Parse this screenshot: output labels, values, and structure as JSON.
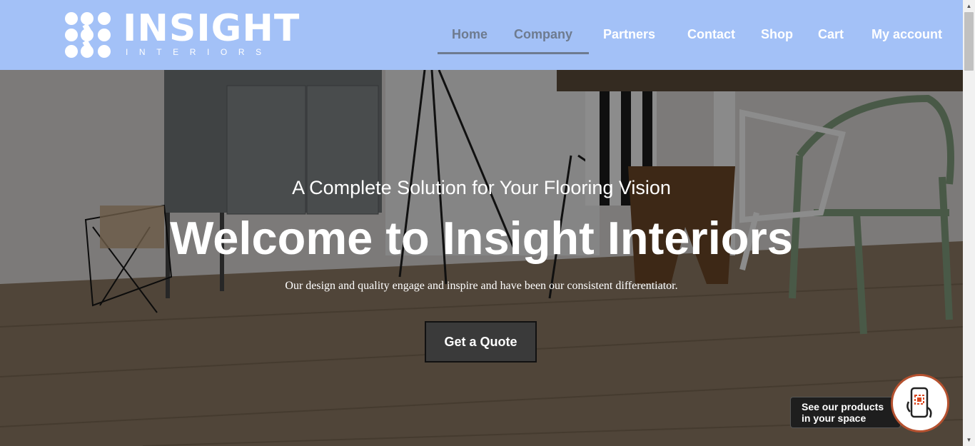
{
  "brand": {
    "name": "INSIGHT",
    "sub": "INTERIORS"
  },
  "nav": {
    "items": [
      {
        "label": "Home",
        "active": true
      },
      {
        "label": "Company",
        "active": false
      },
      {
        "label": "Partners",
        "active": false
      },
      {
        "label": "Contact",
        "active": false
      },
      {
        "label": "Shop",
        "active": false
      },
      {
        "label": "Cart",
        "active": false
      },
      {
        "label": "My account",
        "active": false
      }
    ]
  },
  "hero": {
    "tagline": "A Complete Solution for Your Flooring Vision",
    "title": "Welcome to Insight Interiors",
    "description": "Our design and quality engage and inspire and have been our consistent differentiator.",
    "cta_label": "Get a Quote"
  },
  "ar_widget": {
    "line1": "See our products",
    "line2": "in your space",
    "icon": "phone-ar-icon"
  },
  "colors": {
    "header_bg": "#a3c1f7",
    "nav_active": "#6e7b8f",
    "cta_bg": "#3a3a3a",
    "ar_accent": "#b5512f"
  }
}
